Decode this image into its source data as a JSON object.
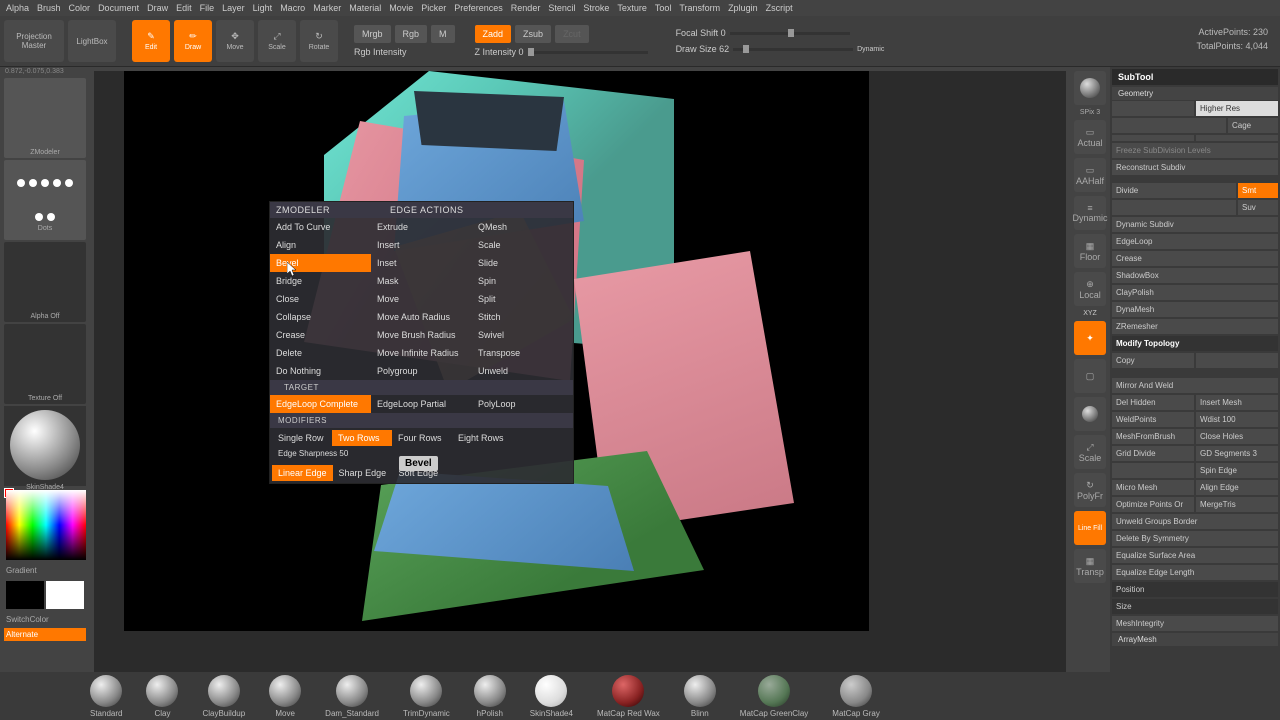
{
  "topmenu": [
    "Alpha",
    "Brush",
    "Color",
    "Document",
    "Draw",
    "Edit",
    "File",
    "Layer",
    "Light",
    "Macro",
    "Marker",
    "Material",
    "Movie",
    "Picker",
    "Preferences",
    "Render",
    "Stencil",
    "Stroke",
    "Texture",
    "Tool",
    "Transform",
    "Zplugin",
    "Zscript"
  ],
  "projection": "Projection Master",
  "lightbox": "LightBox",
  "tb": {
    "edit": "Edit",
    "draw": "Draw",
    "move": "Move",
    "scale": "Scale",
    "rotate": "Rotate"
  },
  "modes": {
    "mrgb": "Mrgb",
    "rgb": "Rgb",
    "m": "M",
    "zadd": "Zadd",
    "zsub": "Zsub",
    "zcut": "Zcut"
  },
  "sliders": {
    "rgbint": "Rgb Intensity",
    "zint": "Z Intensity 0",
    "focal": "Focal Shift 0",
    "dsize": "Draw Size 62",
    "dynamic": "Dynamic"
  },
  "stats": {
    "active": "ActivePoints: 230",
    "total": "TotalPoints: 4,044"
  },
  "leftpanel": {
    "zmodeler": "ZModeler",
    "dots": "Dots",
    "alphaoff": "Alpha Off",
    "texoff": "Texture Off",
    "skin": "SkinShade4",
    "gradient": "Gradient",
    "switch": "SwitchColor",
    "alternate": "Alternate"
  },
  "coords": "0.872,-0.075,0.383",
  "context": {
    "title1": "ZMODELER",
    "title2": "EDGE ACTIONS",
    "actions": [
      "Add To Curve",
      "Extrude",
      "QMesh",
      "Align",
      "Insert",
      "Scale",
      "Bevel",
      "Inset",
      "Slide",
      "Bridge",
      "Mask",
      "Spin",
      "Close",
      "Move",
      "Split",
      "Collapse",
      "Move Auto Radius",
      "Stitch",
      "Crease",
      "Move Brush Radius",
      "Swivel",
      "Delete",
      "Move Infinite Radius",
      "Transpose",
      "Do Nothing",
      "Polygroup",
      "Unweld"
    ],
    "active_action": "Bevel",
    "target_h": "TARGET",
    "targets": [
      "EdgeLoop Complete",
      "EdgeLoop Partial",
      "PolyLoop"
    ],
    "active_target": "EdgeLoop Complete",
    "mod_h": "MODIFIERS",
    "mods_row1": [
      "Single Row",
      "Two Rows",
      "Four Rows",
      "Eight Rows"
    ],
    "active_mod1": "Two Rows",
    "edge_sharp": "Edge Sharpness 50",
    "mods_row2": [
      "Linear Edge",
      "Sharp Edge",
      "Soft Edge"
    ],
    "active_mod2": "Linear Edge",
    "tooltip": "Bevel"
  },
  "rightbtns": {
    "spix": "SPix 3",
    "actual": "Actual",
    "aahalf": "AAHalf",
    "dynamic": "Dynamic",
    "frame": "Floor",
    "local": "Local",
    "xyz": "XYZ",
    "scale": "Scale",
    "polyfr": "PolyFr",
    "linefill": "Line Fill",
    "transp": "Transp"
  },
  "rpanel": {
    "subtool": "SubTool",
    "geometry": "Geometry",
    "higherres": "Higher Res",
    "cage": "Cage",
    "freeze": "Freeze SubDivision Levels",
    "reconstruct": "Reconstruct Subdiv",
    "divide": "Divide",
    "smt": "Smt",
    "suv": "Suv",
    "dynsubd": "Dynamic Subdiv",
    "edgeloop": "EdgeLoop",
    "crease": "Crease",
    "shadowbox": "ShadowBox",
    "claypolish": "ClayPolish",
    "dynamesh": "DynaMesh",
    "zremesher": "ZRemesher",
    "modtop": "Modify Topology",
    "copy": "Copy",
    "mirror": "Mirror And Weld",
    "delhidden": "Del Hidden",
    "insertmesh": "Insert Mesh",
    "weldpoints": "WeldPoints",
    "wdist": "Wdist 100",
    "meshfrom": "MeshFromBrush",
    "closeholes": "Close Holes",
    "griddiv": "Grid Divide",
    "gdseg": "GD Segments 3",
    "spinedge": "Spin Edge",
    "micromesh": "Micro Mesh",
    "alignedge": "Align Edge",
    "optpts": "Optimize Points Or",
    "mergetris": "MergeTris",
    "unweldgrp": "Unweld Groups Border",
    "delbysym": "Delete By Symmetry",
    "eqsurf": "Equalize Surface Area",
    "eqedge": "Equalize Edge Length",
    "position": "Position",
    "size": "Size",
    "meshint": "MeshIntegrity",
    "arraymesh": "ArrayMesh"
  },
  "brushes": [
    "Standard",
    "Clay",
    "ClayBuildup",
    "Move",
    "Dam_Standard",
    "TrimDynamic",
    "hPolish",
    "SkinShade4",
    "MatCap Red Wax",
    "Blinn",
    "MatCap GreenClay",
    "MatCap Gray"
  ]
}
